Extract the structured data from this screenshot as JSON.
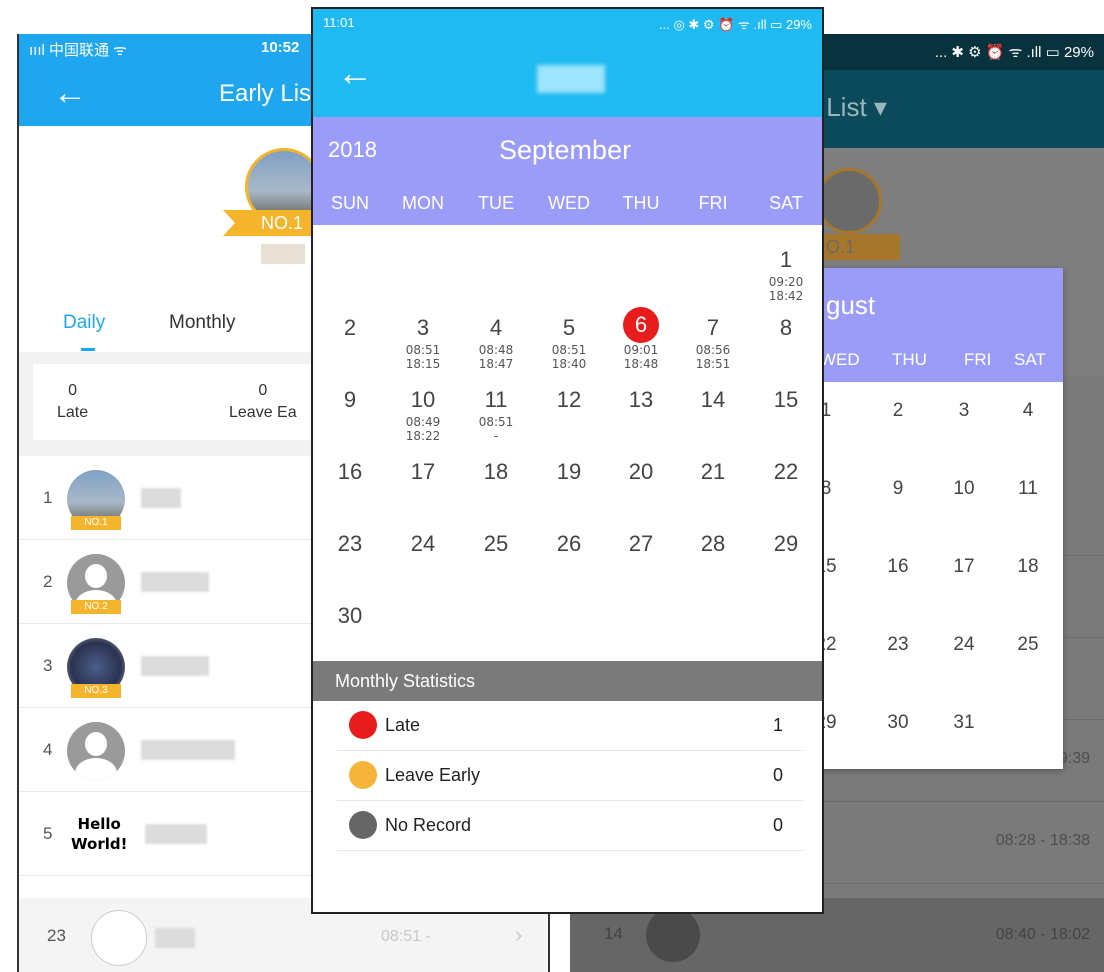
{
  "left": {
    "status_carrier": "ıııl 中国联通 ᯤ",
    "status_time": "10:52",
    "title": "Early Lis",
    "hero_rank": "NO.1",
    "tabs": [
      "Daily",
      "Monthly"
    ],
    "stats": [
      {
        "value": "0",
        "label": "Late"
      },
      {
        "value": "0",
        "label": "Leave Ea"
      }
    ],
    "rows": [
      {
        "rank": "1",
        "badge": "NO.1"
      },
      {
        "rank": "2",
        "badge": "NO.2"
      },
      {
        "rank": "3",
        "badge": "NO.3"
      },
      {
        "rank": "4",
        "badge": ""
      },
      {
        "rank": "5",
        "badge": ""
      }
    ],
    "hello_line1": "Hello",
    "hello_line2": "World!",
    "footer_rank": "23",
    "footer_time": "08:51 -"
  },
  "right": {
    "status_icons": "... ✱ ⚙ ⏰ ᯤ .ıll ▭ 29%",
    "title": "y List ▾",
    "hero_rank": "O.1",
    "row_times": [
      "",
      "",
      "",
      "08:20 - 19:39",
      "08:28 - 18:38"
    ],
    "footer_rank": "14",
    "footer_time": "08:40 - 18:02"
  },
  "august_popup": {
    "month": "gust",
    "weekdays": [
      "WED",
      "THU",
      "FRI",
      "SAT"
    ],
    "weeks": [
      [
        "1",
        "2",
        "3",
        "4"
      ],
      [
        "8",
        "9",
        "10",
        "11"
      ],
      [
        "15",
        "16",
        "17",
        "18"
      ],
      [
        "22",
        "23",
        "24",
        "25"
      ],
      [
        "29",
        "30",
        "31",
        ""
      ]
    ]
  },
  "center": {
    "status_time": "11:01",
    "status_icons": "... ◎ ✱ ⚙ ⏰ ᯤ .ıll ▭ 29%",
    "back_icon": "←",
    "year": "2018",
    "month": "September",
    "weekdays": [
      "SUN",
      "MON",
      "TUE",
      "WED",
      "THU",
      "FRI",
      "SAT"
    ],
    "weeks": [
      [
        {
          "d": ""
        },
        {
          "d": ""
        },
        {
          "d": ""
        },
        {
          "d": ""
        },
        {
          "d": ""
        },
        {
          "d": ""
        },
        {
          "d": "1",
          "in": "09:20",
          "out": "18:42"
        }
      ],
      [
        {
          "d": "2"
        },
        {
          "d": "3",
          "in": "08:51",
          "out": "18:15"
        },
        {
          "d": "4",
          "in": "08:48",
          "out": "18:47"
        },
        {
          "d": "5",
          "in": "08:51",
          "out": "18:40"
        },
        {
          "d": "6",
          "in": "09:01",
          "out": "18:48",
          "today": true
        },
        {
          "d": "7",
          "in": "08:56",
          "out": "18:51"
        },
        {
          "d": "8"
        }
      ],
      [
        {
          "d": "9"
        },
        {
          "d": "10",
          "in": "08:49",
          "out": "18:22"
        },
        {
          "d": "11",
          "in": "08:51",
          "out": "-"
        },
        {
          "d": "12"
        },
        {
          "d": "13"
        },
        {
          "d": "14"
        },
        {
          "d": "15"
        }
      ],
      [
        {
          "d": "16"
        },
        {
          "d": "17"
        },
        {
          "d": "18"
        },
        {
          "d": "19"
        },
        {
          "d": "20"
        },
        {
          "d": "21"
        },
        {
          "d": "22"
        }
      ],
      [
        {
          "d": "23"
        },
        {
          "d": "24"
        },
        {
          "d": "25"
        },
        {
          "d": "26"
        },
        {
          "d": "27"
        },
        {
          "d": "28"
        },
        {
          "d": "29"
        }
      ],
      [
        {
          "d": "30"
        },
        {
          "d": ""
        },
        {
          "d": ""
        },
        {
          "d": ""
        },
        {
          "d": ""
        },
        {
          "d": ""
        },
        {
          "d": ""
        }
      ]
    ],
    "stats_title": "Monthly Statistics",
    "stats": [
      {
        "label": "Late",
        "value": "1",
        "color": "#e81c1c"
      },
      {
        "label": "Leave Early",
        "value": "0",
        "color": "#f7b43a"
      },
      {
        "label": "No Record",
        "value": "0",
        "color": "#666666"
      }
    ]
  },
  "colors": {
    "app_blue": "#1ebaf1",
    "calendar_header": "#9a9cf7",
    "today": "#e81c1c",
    "ribbon_gold": "#f4b52d"
  }
}
